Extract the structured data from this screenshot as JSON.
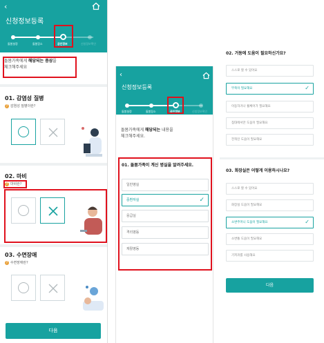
{
  "panel1": {
    "title": "신청정보등록",
    "steps": [
      "돌봄설정",
      "돌봄장소",
      "공인정보",
      "신청정보확인"
    ],
    "notice_pre": "돌봄가족에게 ",
    "notice_bold": "해당되는 증상",
    "notice_post": "을",
    "notice_line2": "체크해주세요",
    "questions": [
      {
        "title": "01. 감염성 질병",
        "sub": "감염성 질병이란?"
      },
      {
        "title": "02. 마비",
        "sub": "마비란?"
      },
      {
        "title": "03. 수면장애",
        "sub": "수면장애란?"
      }
    ],
    "o_symbol": "O",
    "x_symbol": "✕",
    "next_label": "다음"
  },
  "panel2": {
    "title": "신청정보등록",
    "steps": [
      "돌봄설정",
      "돌봄장소",
      "공인정보",
      "신청정보확인"
    ],
    "notice_pre": "돌봄가족에게 ",
    "notice_bold": "해당되는",
    "notice_post": " 내용을",
    "notice_line2": "체크해주세요.",
    "question": "01. 돌봄가족이 계신 병실을 알려주세요.",
    "options": [
      "일반병실",
      "중환자실",
      "응급실",
      "격리병동",
      "재활병동"
    ],
    "selected_index": 1
  },
  "panel3": {
    "q2": "02. 거동에 도움이 필요하신가요?",
    "q2_options": [
      "스스로 할 수 있어요",
      "부축이 필요해요",
      "이동하거나 휠체어가 필요해요",
      "침대에서만 도움이 필요해요",
      "전적인 도움이 필요해요"
    ],
    "q2_selected": 1,
    "q3": "03. 화장실은 어떻게 이용하시나요?",
    "q3_options": [
      "스스로 할 수 있어요",
      "화장실 도움이 필요해요",
      "소변주머니 도움이 필요해요",
      "소변통 도움이 필요해요",
      "기저귀를 사용해요"
    ],
    "q3_selected": 2,
    "next_label": "다음"
  },
  "colors": {
    "primary": "#17a2a0",
    "highlight": "#e0101c"
  }
}
